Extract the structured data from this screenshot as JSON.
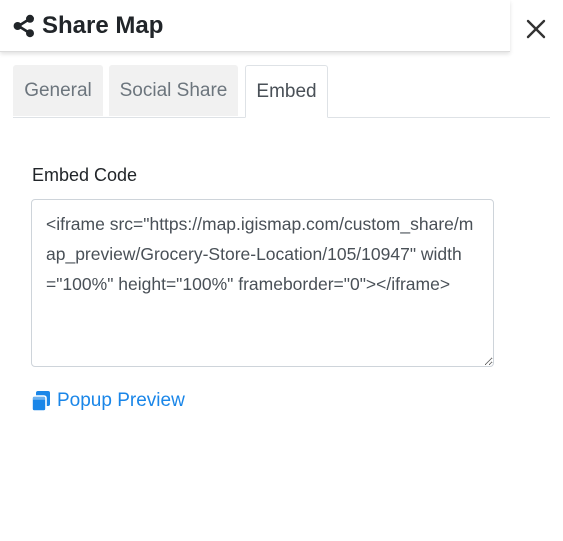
{
  "modal": {
    "title": "Share Map",
    "close_symbol": "✕"
  },
  "icons": {
    "title_icon": "share-icon",
    "close_icon": "close-icon",
    "preview_icon": "window-restore-icon"
  },
  "tabs": [
    {
      "label": "General",
      "active": false
    },
    {
      "label": "Social Share",
      "active": false
    },
    {
      "label": "Embed",
      "active": true
    }
  ],
  "embed": {
    "label": "Embed Code",
    "code": "<iframe src=\"https://map.igismap.com/custom_share/map_preview/Grocery-Store-Location/105/10947\" width=\"100%\" height=\"100%\" frameborder=\"0\"></iframe>"
  },
  "preview": {
    "label": "Popup Preview"
  },
  "colors": {
    "link": "#1a86e8",
    "text": "#212529",
    "tab_inactive_bg": "#f1f1f1"
  }
}
